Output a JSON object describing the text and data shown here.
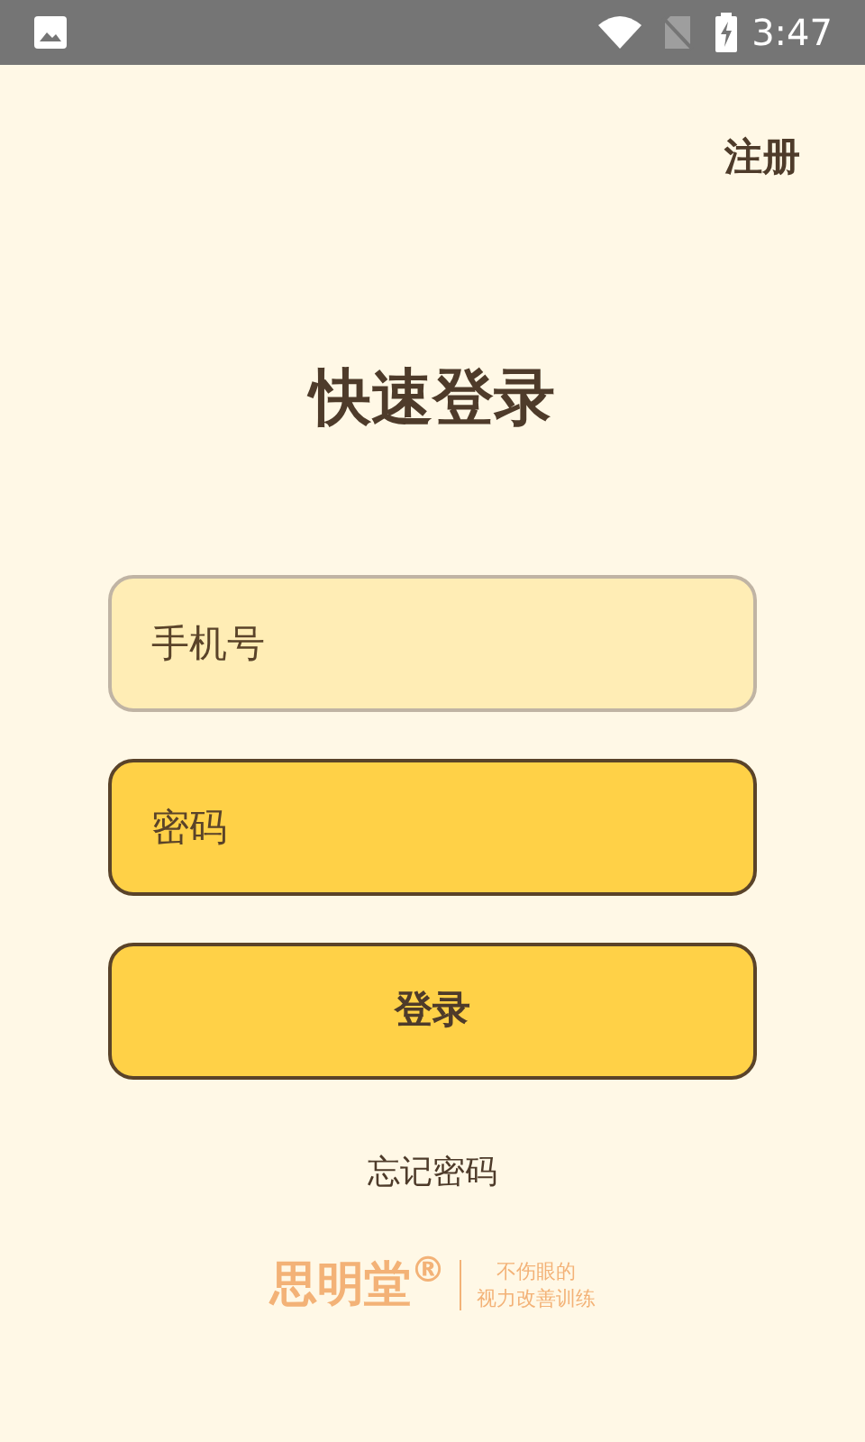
{
  "status_bar": {
    "time": "3:47"
  },
  "header": {
    "register_link": "注册"
  },
  "title": "快速登录",
  "phone_field": {
    "placeholder": "手机号",
    "focused": false
  },
  "password_field": {
    "placeholder": "密码",
    "focused": true
  },
  "login_button": "登录",
  "forgot_password_link": "忘记密码",
  "brand": {
    "name": "思明堂$^{®}$",
    "tagline": [
      "不伤眼的",
      "视力改善训练"
    ]
  }
}
